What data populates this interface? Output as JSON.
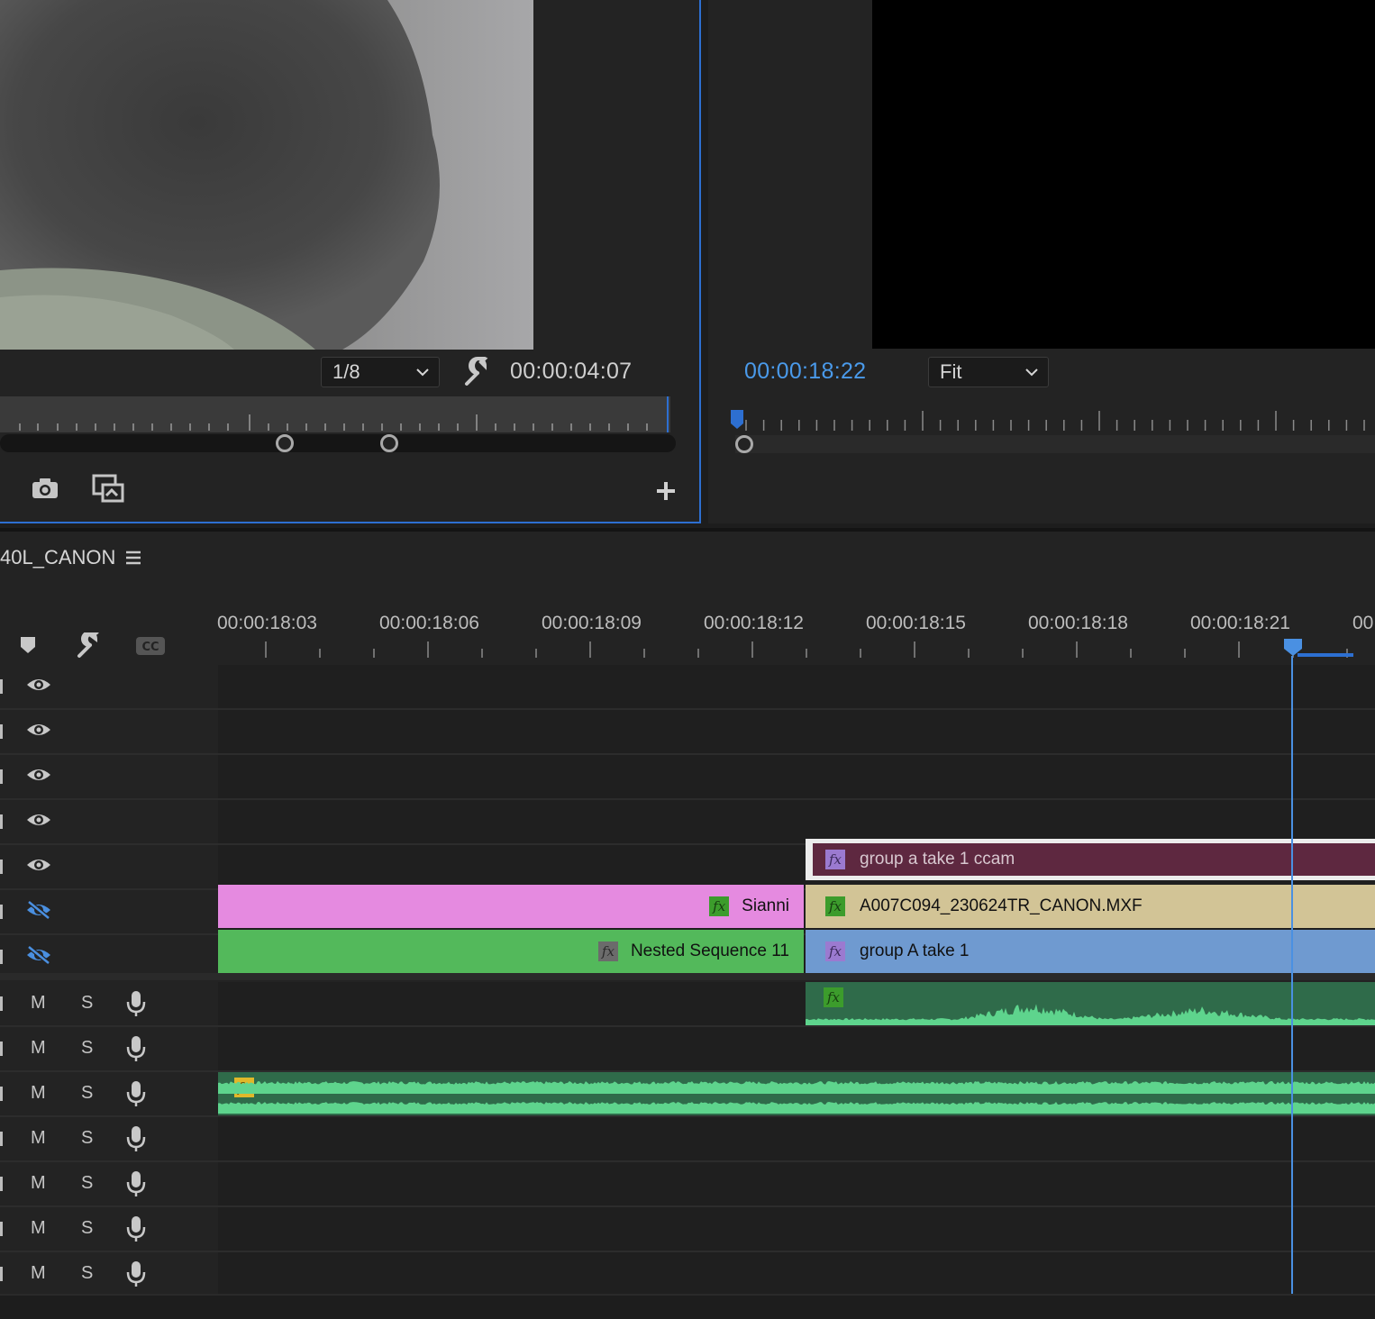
{
  "source_monitor": {
    "resolution": "1/8",
    "timecode": "00:00:04:07"
  },
  "program_monitor": {
    "timecode": "00:00:18:22",
    "zoom": "Fit"
  },
  "timeline": {
    "sequence_title": "40L_CANON",
    "ruler_labels": [
      "00:00:18:03",
      "00:00:18:06",
      "00:00:18:09",
      "00:00:18:12",
      "00:00:18:15",
      "00:00:18:18",
      "00:00:18:21",
      "00"
    ],
    "clips": {
      "v3_clip": "group a take 1 ccam",
      "v2_left": "Sianni",
      "v2_right": "A007C094_230624TR_CANON.MXF",
      "v1_left": "Nested Sequence 11",
      "v1_right": "group A take 1"
    },
    "audio_mute_label": "M",
    "audio_solo_label": "S",
    "fx_label": "fx"
  },
  "colors": {
    "accent": "#2d6fd1",
    "playhead": "#4a90e2",
    "clip_maroon": "#5e2840",
    "clip_pink": "#e58ae0",
    "clip_tan": "#d2c496",
    "clip_green": "#53b95b",
    "clip_blue": "#6f9ad0",
    "audio_green": "#5ed48d"
  }
}
